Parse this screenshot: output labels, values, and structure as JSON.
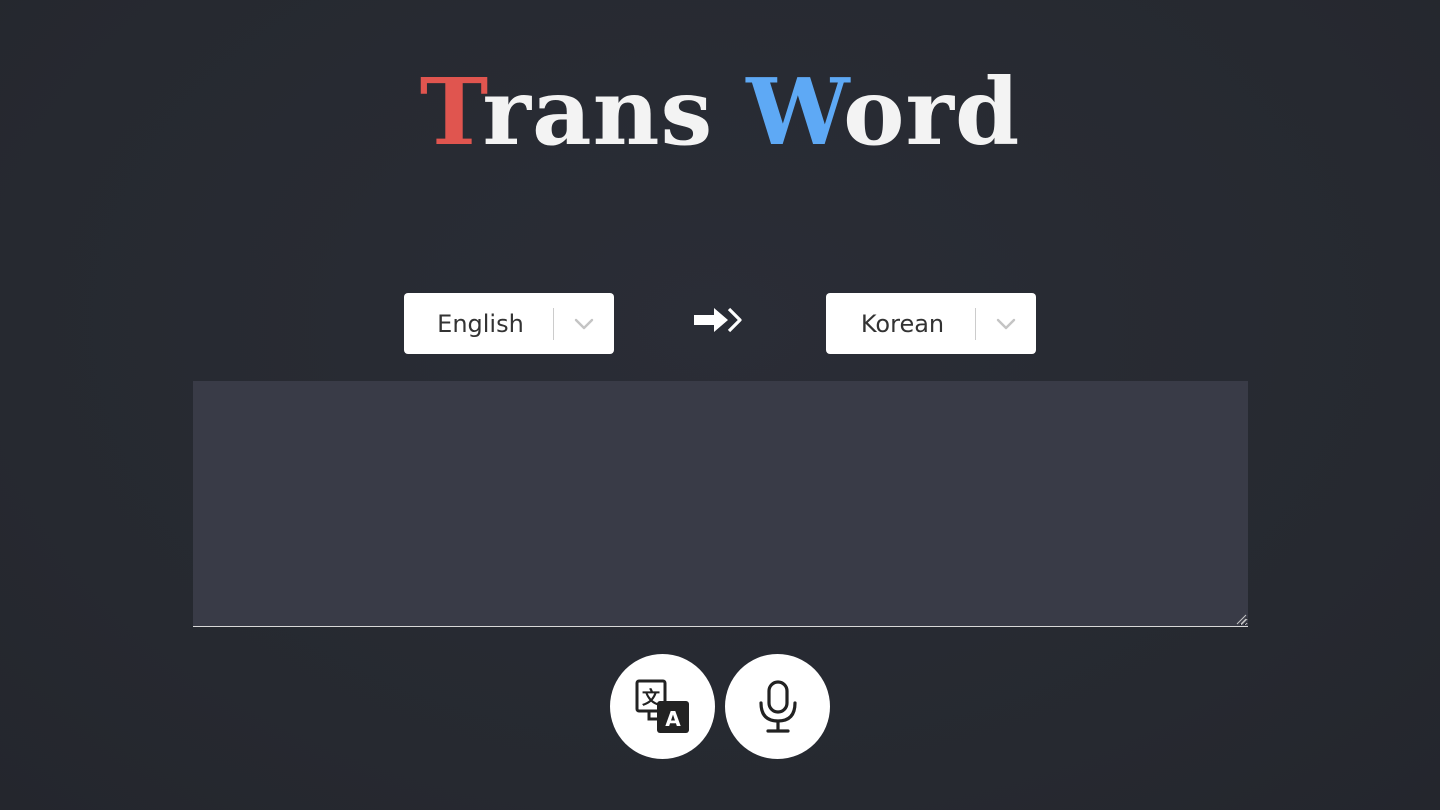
{
  "logo": {
    "first_initial": "T",
    "first_rest": "rans",
    "second_initial": "W",
    "second_rest": "ord",
    "colors": {
      "first_initial": "#e0554f",
      "second_initial": "#5ea9f5",
      "rest": "#f3f3f3"
    }
  },
  "source_language": {
    "selected": "English",
    "icon": "chevron-down-icon"
  },
  "target_language": {
    "selected": "Korean",
    "icon": "chevron-down-icon"
  },
  "swap": {
    "icon": "double-arrow-right-icon"
  },
  "input": {
    "value": "",
    "placeholder": ""
  },
  "actions": {
    "translate_icon": "translate-icon",
    "mic_icon": "microphone-icon"
  },
  "theme": {
    "background": "#272a33",
    "textarea_bg": "#393b47"
  }
}
